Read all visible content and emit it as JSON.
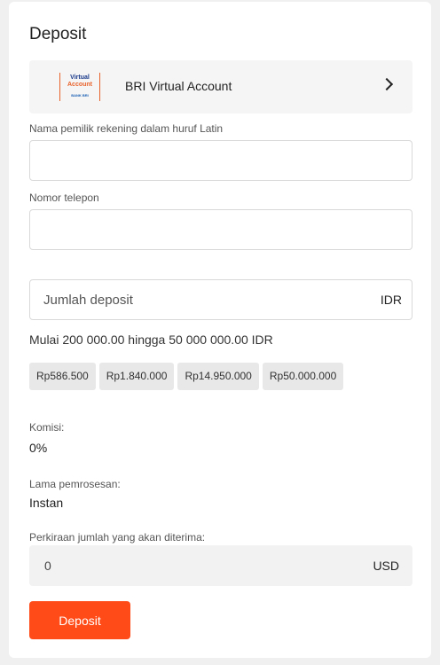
{
  "title": "Deposit",
  "method": {
    "name": "BRI Virtual Account",
    "logo_line1": "Virtual",
    "logo_line2": "Account",
    "logo_bank": "BANK BRI"
  },
  "holder_field": {
    "label": "Nama pemilik rekening dalam huruf Latin",
    "value": ""
  },
  "phone_field": {
    "label": "Nomor telepon",
    "value": ""
  },
  "amount_field": {
    "placeholder": "Jumlah deposit",
    "currency": "IDR"
  },
  "range_text": "Mulai 200 000.00 hingga 50 000 000.00 IDR",
  "presets": [
    "Rp586.500",
    "Rp1.840.000",
    "Rp14.950.000",
    "Rp50.000.000"
  ],
  "commission": {
    "label": "Komisi:",
    "value": "0%"
  },
  "processing": {
    "label": "Lama pemrosesan:",
    "value": "Instan"
  },
  "estimate": {
    "label": "Perkiraan jumlah yang akan diterima:",
    "value": "0",
    "currency": "USD"
  },
  "submit_label": "Deposit",
  "colors": {
    "accent": "#ff4b17",
    "panel": "#f5f5f5"
  }
}
